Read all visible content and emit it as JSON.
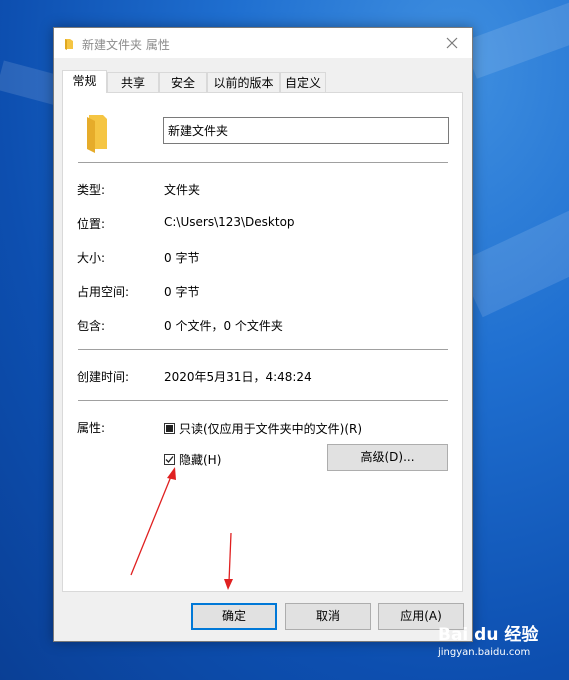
{
  "window": {
    "title": "新建文件夹 属性",
    "close_glyph": "✕"
  },
  "tabs": [
    {
      "label": "常规",
      "active": true
    },
    {
      "label": "共享"
    },
    {
      "label": "安全"
    },
    {
      "label": "以前的版本"
    },
    {
      "label": "自定义"
    }
  ],
  "general": {
    "folder_name": "新建文件夹",
    "rows": [
      {
        "label": "类型:",
        "value": "文件夹"
      },
      {
        "label": "位置:",
        "value": "C:\\Users\\123\\Desktop"
      },
      {
        "label": "大小:",
        "value": "0 字节"
      },
      {
        "label": "占用空间:",
        "value": "0 字节"
      },
      {
        "label": "包含:",
        "value": "0 个文件，0 个文件夹"
      }
    ],
    "created": {
      "label": "创建时间:",
      "value": "2020年5月31日，4:48:24"
    },
    "attributes": {
      "label": "属性:",
      "readonly": {
        "label": "只读(仅应用于文件夹中的文件)(R)",
        "state": "indeterminate"
      },
      "hidden": {
        "label": "隐藏(H)",
        "checked": true
      },
      "advanced_label": "高级(D)..."
    }
  },
  "footer": {
    "ok_label": "确定",
    "cancel_label": "取消",
    "apply_label": "应用(A)"
  },
  "watermark": {
    "main": "Bai du 经验",
    "sub": "jingyan.baidu.com"
  },
  "colors": {
    "annotation_arrow": "#e02020",
    "folder": "#f5c543",
    "focus_border": "#0078d7"
  }
}
